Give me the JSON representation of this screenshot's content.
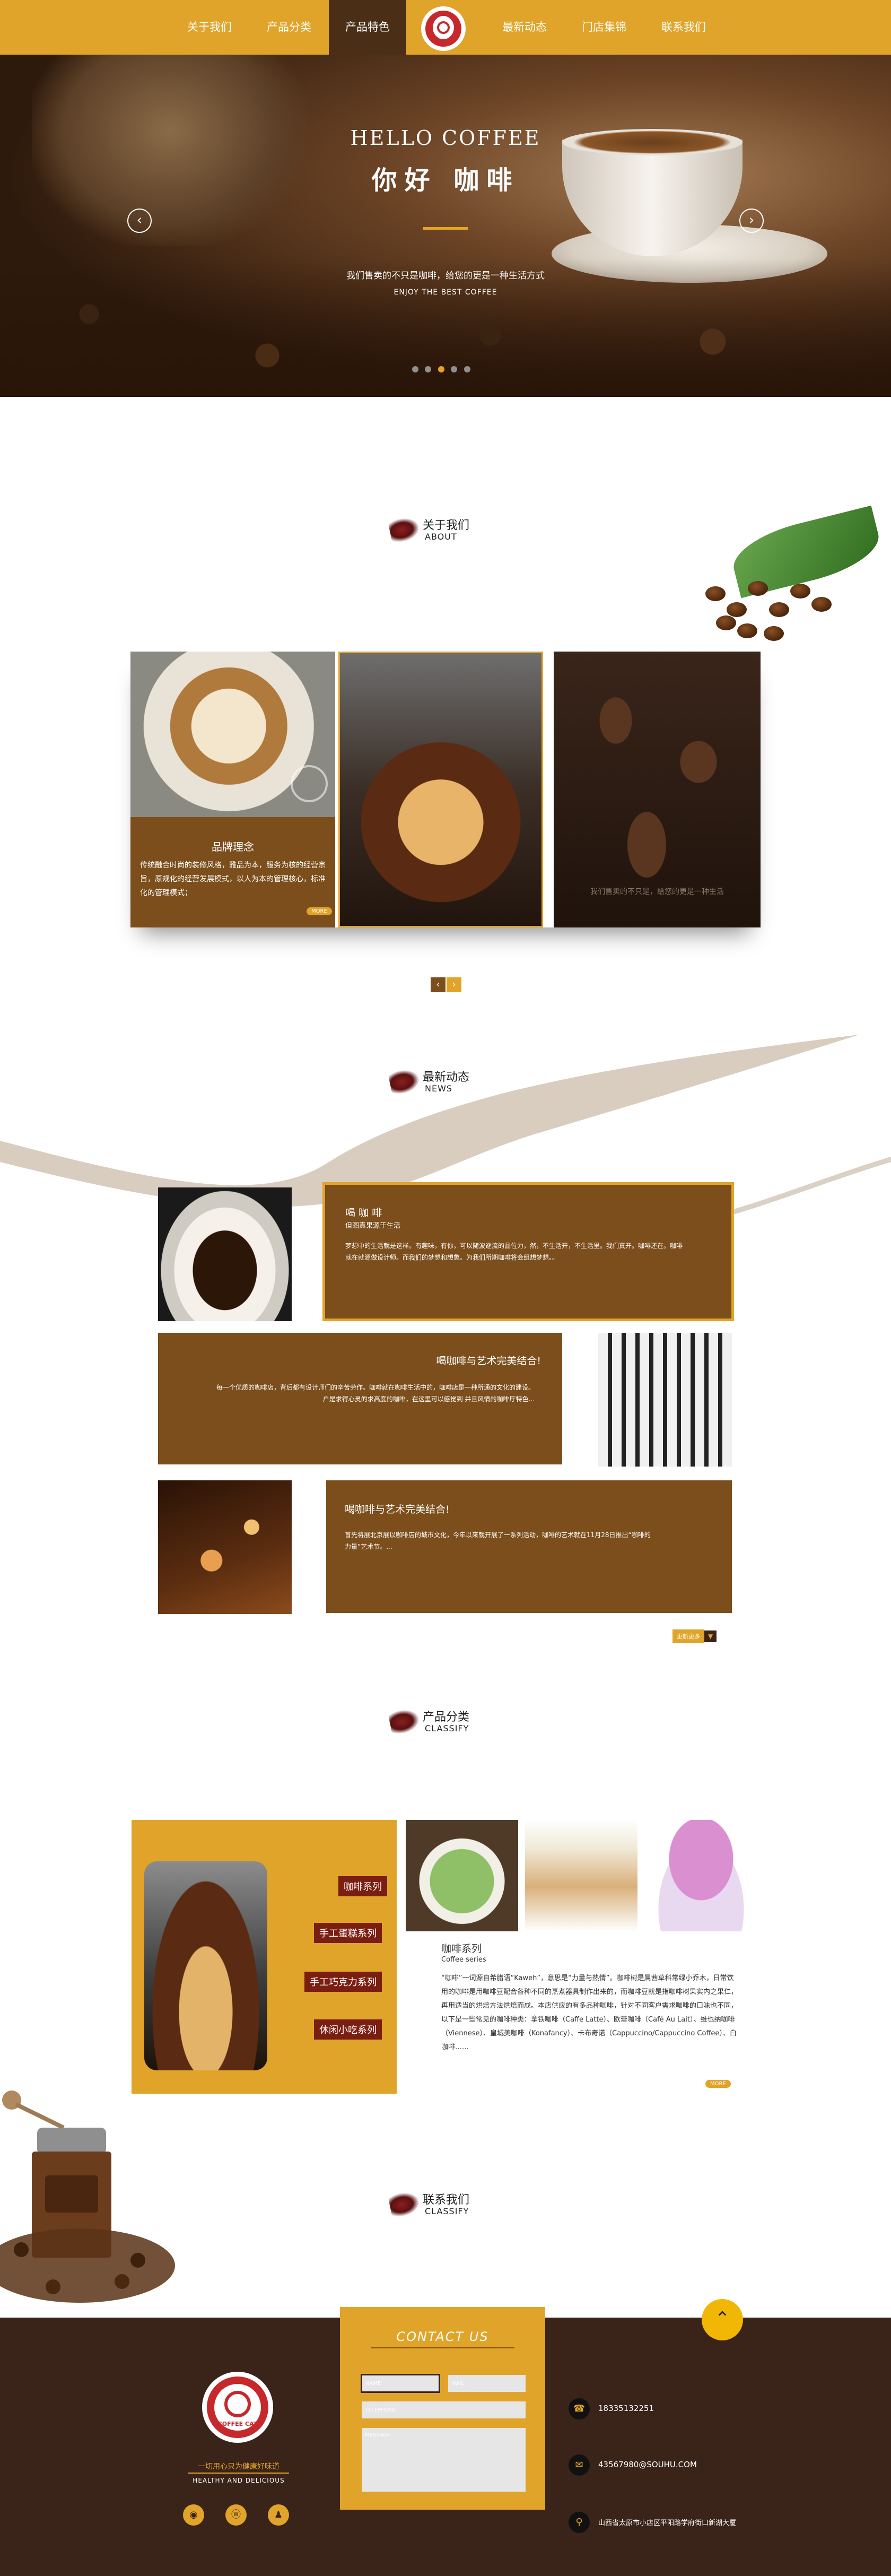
{
  "nav": {
    "items": [
      "关于我们",
      "产品分类",
      "产品特色",
      "最新动态",
      "门店集锦",
      "联系我们"
    ],
    "active_index": 2,
    "logo_text": "COFFEE CAT"
  },
  "hero": {
    "title_en": "HELLO COFFEE",
    "title_cn": "你好 咖啡",
    "subtitle_cn": "我们售卖的不只是咖啡，给您的更是一种生活方式",
    "subtitle_en": "ENJOY THE BEST COFFEE",
    "prev_icon": "‹",
    "next_icon": "›",
    "dots": 5,
    "active_dot": 2
  },
  "about": {
    "title_cn": "关于我们",
    "title_en": "ABOUT",
    "card1_title": "品牌理念",
    "card1_text": "传统融合时尚的装修风格，雅品为本，服务为核的经营宗旨，原规化的经营发展模式，以人为本的管理核心，标准化的管理模式；",
    "card1_more": "MORE",
    "card3_caption": "我们售卖的不只是，给您的更是一种生活",
    "pager_prev": "‹",
    "pager_next": "›"
  },
  "news": {
    "title_cn": "最新动态",
    "title_en": "NEWS",
    "items": [
      {
        "title": "喝 咖 啡",
        "sub": "但图真果源于生活",
        "text": "梦想中的生活就是这样。有趣味，有你，可以随波逐流的品位力，然，不生活开，不生活里。我们真开。咖啡还在。咖啡就在就源做设计师。而我们的梦想和想象。为我们所期咖啡将会组想梦想。。"
      },
      {
        "title": "喝咖啡与艺术完美结合!",
        "text": "每一个优质的咖啡店，背后都有设计师们的辛苦劳作。咖啡就在咖啡生活中的，咖啡店是一种所通的文化的建设。",
        "text2": "户是求得心灵的求高度的咖啡，在这里可以感觉到  并且风情的咖啡厅特色..."
      },
      {
        "title": "喝咖啡与艺术完美结合!",
        "text": "首先将展北京展以咖啡店的城市文化，今年以来就开展了一系列活动，咖啡的艺术就在11月28日推出“咖啡的",
        "text2": "力量”艺术节。..."
      }
    ],
    "more_label": "更新更多",
    "more_icon": "▼"
  },
  "classify": {
    "title_cn": "产品分类",
    "title_en": "CLASSIFY",
    "tags": [
      "咖啡系列",
      "手工蛋糕系列",
      "手工巧克力系列",
      "休闲小吃系列"
    ],
    "product_title": "咖啡系列",
    "product_sub": "Coffee series",
    "product_text": "“咖啡”一词源自希腊语“Kaweh”，意思是“力量与热情”。咖啡树是属茜草科常绿小乔木，日常饮用的咖啡是用咖啡豆配合各种不同的烹煮器具制作出来的，而咖啡豆就是指咖啡树果实内之果仁，再用适当的烘焙方法烘焙而成。本店供应的有多品种咖啡，针对不同客户需求咖啡的口味也不同，以下是一些常见的咖啡种类：拿铁咖啡（Caffe Latte）、欧蕾咖啡（Café Au Lait）、维也纳咖啡（Viennese）、皇城美咖啡（Konafancy）、卡布奇诺（Cappuccino/Cappuccino Coffee）、白咖啡……",
    "more": "MORE"
  },
  "contact": {
    "title_cn": "联系我们",
    "title_en": "CLASSIFY",
    "form_title": "CONTACT US",
    "name_ph": "NAME",
    "mail_ph": "MAIL",
    "tel_ph": "TELEPHONE",
    "msg_ph": "MESSAGE",
    "up_icon": "⌃"
  },
  "footer": {
    "logo_text": "COFFEE CAT",
    "slogan_cn": "一切用心只为健康好味道",
    "slogan_en": "HEALTHY AND DELICIOUS",
    "social_icons": [
      "◉",
      "ⓦ",
      "♟"
    ],
    "phone": "18335132251",
    "email": "43567980@SOUHU.COM",
    "address": "山西省太原市小店区平阳路学府街口新湖大厦",
    "phone_icon": "☎",
    "mail_icon": "✉",
    "pin_icon": "⚲"
  },
  "colors": {
    "primary": "#e1a42a",
    "brown": "#7b4e1c",
    "dark": "#3a2319",
    "logo_red": "#c6282b"
  }
}
